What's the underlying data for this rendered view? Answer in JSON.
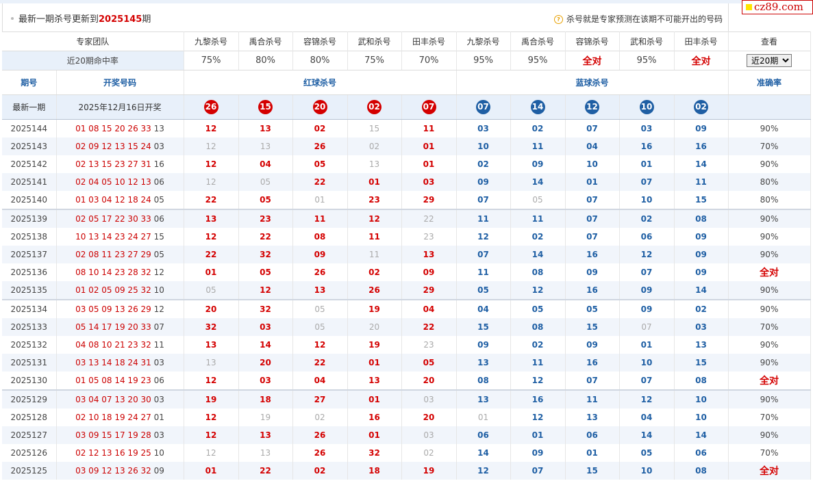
{
  "header": {
    "title_prefix": "最新一期杀号更新到",
    "title_issue": "2025145",
    "title_suffix": "期",
    "note_icon": "question-icon",
    "note": "杀号就是专家预测在该期不可能开出的号码"
  },
  "logo": "cz89.com",
  "teams_label": "专家团队",
  "teams": [
    "九黎杀号",
    "禹合杀号",
    "容锦杀号",
    "武和杀号",
    "田丰杀号",
    "九黎杀号",
    "禹合杀号",
    "容锦杀号",
    "武和杀号",
    "田丰杀号"
  ],
  "view_label": "查看",
  "rate_label": "近20期命中率",
  "rates": [
    "75%",
    "80%",
    "80%",
    "75%",
    "70%",
    "95%",
    "95%",
    "全对",
    "95%",
    "全对"
  ],
  "view_select": "近20期",
  "columns": {
    "period": "期号",
    "draw": "开奖号码",
    "red": "红球杀号",
    "blue": "蓝球杀号",
    "accuracy": "准确率"
  },
  "latest": {
    "label": "最新一期",
    "date": "2025年12月16日开奖",
    "red_balls": [
      "26",
      "15",
      "20",
      "02",
      "07"
    ],
    "blue_balls": [
      "07",
      "14",
      "12",
      "10",
      "02"
    ]
  },
  "rows": [
    {
      "period": "2025144",
      "red": "01 08 15 20 26 33",
      "blue": "13",
      "kills": [
        "12",
        "13",
        "02",
        "15",
        "11",
        "03",
        "02",
        "07",
        "03",
        "09"
      ],
      "miss": [
        3
      ],
      "acc": "90%"
    },
    {
      "period": "2025143",
      "red": "02 09 12 13 15 24",
      "blue": "03",
      "kills": [
        "12",
        "13",
        "26",
        "02",
        "01",
        "10",
        "11",
        "04",
        "16",
        "16"
      ],
      "miss": [
        0,
        1,
        3
      ],
      "acc": "70%"
    },
    {
      "period": "2025142",
      "red": "02 13 15 23 27 31",
      "blue": "16",
      "kills": [
        "12",
        "04",
        "05",
        "13",
        "01",
        "02",
        "09",
        "10",
        "01",
        "14"
      ],
      "miss": [
        3
      ],
      "acc": "90%"
    },
    {
      "period": "2025141",
      "red": "02 04 05 10 12 13",
      "blue": "06",
      "kills": [
        "12",
        "05",
        "22",
        "01",
        "03",
        "09",
        "14",
        "01",
        "07",
        "11"
      ],
      "miss": [
        0,
        1
      ],
      "acc": "80%"
    },
    {
      "period": "2025140",
      "red": "01 03 04 12 18 24",
      "blue": "05",
      "kills": [
        "22",
        "05",
        "01",
        "23",
        "29",
        "07",
        "05",
        "07",
        "10",
        "15"
      ],
      "miss": [
        2,
        6
      ],
      "acc": "80%"
    },
    {
      "period": "2025139",
      "red": "02 05 17 22 30 33",
      "blue": "06",
      "kills": [
        "13",
        "23",
        "11",
        "12",
        "22",
        "11",
        "11",
        "07",
        "02",
        "08"
      ],
      "miss": [
        4
      ],
      "acc": "90%"
    },
    {
      "period": "2025138",
      "red": "10 13 14 23 24 27",
      "blue": "15",
      "kills": [
        "12",
        "22",
        "08",
        "11",
        "23",
        "12",
        "02",
        "07",
        "06",
        "09"
      ],
      "miss": [
        4
      ],
      "acc": "90%"
    },
    {
      "period": "2025137",
      "red": "02 08 11 23 27 29",
      "blue": "05",
      "kills": [
        "22",
        "32",
        "09",
        "11",
        "13",
        "07",
        "14",
        "16",
        "12",
        "09"
      ],
      "miss": [
        3
      ],
      "acc": "90%"
    },
    {
      "period": "2025136",
      "red": "08 10 14 23 28 32",
      "blue": "12",
      "kills": [
        "01",
        "05",
        "26",
        "02",
        "09",
        "11",
        "08",
        "09",
        "07",
        "09"
      ],
      "miss": [],
      "acc": "全对"
    },
    {
      "period": "2025135",
      "red": "01 02 05 09 25 32",
      "blue": "10",
      "kills": [
        "05",
        "12",
        "13",
        "26",
        "29",
        "05",
        "12",
        "16",
        "09",
        "14"
      ],
      "miss": [
        0
      ],
      "acc": "90%"
    },
    {
      "period": "2025134",
      "red": "03 05 09 13 26 29",
      "blue": "12",
      "kills": [
        "20",
        "32",
        "05",
        "19",
        "04",
        "04",
        "05",
        "05",
        "09",
        "02"
      ],
      "miss": [
        2
      ],
      "acc": "90%"
    },
    {
      "period": "2025133",
      "red": "05 14 17 19 20 33",
      "blue": "07",
      "kills": [
        "32",
        "03",
        "05",
        "20",
        "22",
        "15",
        "08",
        "15",
        "07",
        "03"
      ],
      "miss": [
        2,
        3,
        8
      ],
      "acc": "70%"
    },
    {
      "period": "2025132",
      "red": "04 08 10 21 23 32",
      "blue": "11",
      "kills": [
        "13",
        "14",
        "12",
        "19",
        "23",
        "09",
        "02",
        "09",
        "01",
        "13"
      ],
      "miss": [
        4
      ],
      "acc": "90%"
    },
    {
      "period": "2025131",
      "red": "03 13 14 18 24 31",
      "blue": "03",
      "kills": [
        "13",
        "20",
        "22",
        "01",
        "05",
        "13",
        "11",
        "16",
        "10",
        "15"
      ],
      "miss": [
        0
      ],
      "acc": "90%"
    },
    {
      "period": "2025130",
      "red": "01 05 08 14 19 23",
      "blue": "06",
      "kills": [
        "12",
        "03",
        "04",
        "13",
        "20",
        "08",
        "12",
        "07",
        "07",
        "08"
      ],
      "miss": [],
      "acc": "全对"
    },
    {
      "period": "2025129",
      "red": "03 04 07 13 20 30",
      "blue": "03",
      "kills": [
        "19",
        "18",
        "27",
        "01",
        "03",
        "13",
        "16",
        "11",
        "12",
        "10"
      ],
      "miss": [
        4
      ],
      "acc": "90%"
    },
    {
      "period": "2025128",
      "red": "02 10 18 19 24 27",
      "blue": "01",
      "kills": [
        "12",
        "19",
        "02",
        "16",
        "20",
        "01",
        "12",
        "13",
        "04",
        "10"
      ],
      "miss": [
        1,
        2,
        5
      ],
      "acc": "70%"
    },
    {
      "period": "2025127",
      "red": "03 09 15 17 19 28",
      "blue": "03",
      "kills": [
        "12",
        "13",
        "26",
        "01",
        "03",
        "06",
        "01",
        "06",
        "14",
        "14"
      ],
      "miss": [
        4
      ],
      "acc": "90%"
    },
    {
      "period": "2025126",
      "red": "02 12 13 16 19 25",
      "blue": "10",
      "kills": [
        "12",
        "13",
        "26",
        "32",
        "02",
        "14",
        "09",
        "01",
        "05",
        "06"
      ],
      "miss": [
        0,
        1,
        4
      ],
      "acc": "70%"
    },
    {
      "period": "2025125",
      "red": "03 09 12 13 26 32",
      "blue": "09",
      "kills": [
        "01",
        "22",
        "02",
        "18",
        "19",
        "12",
        "07",
        "15",
        "10",
        "08"
      ],
      "miss": [],
      "acc": "全对"
    }
  ]
}
